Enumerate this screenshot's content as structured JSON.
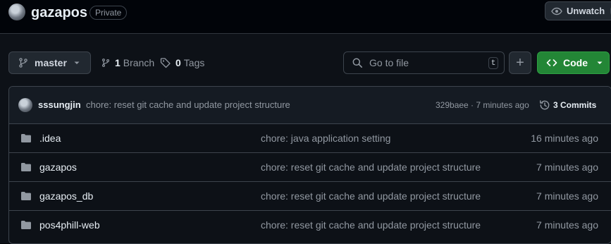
{
  "header": {
    "repo_name": "gazapos",
    "visibility_badge": "Private",
    "unwatch_label": "Unwatch"
  },
  "toolbar": {
    "branch_name": "master",
    "branch_count": "1",
    "branch_label": "Branch",
    "tag_count": "0",
    "tag_label": "Tags",
    "search_placeholder": "Go to file",
    "search_shortcut": "t",
    "add_label": "+",
    "code_label": "Code"
  },
  "latest_commit": {
    "author": "sssungjin",
    "message": "chore: reset git cache and update project structure",
    "hash_time": "329baee · 7 minutes ago",
    "commits_label": "3 Commits"
  },
  "files": [
    {
      "name": ".idea",
      "message": "chore: java application setting",
      "time": "16 minutes ago",
      "icon": "folder-icon"
    },
    {
      "name": "gazapos",
      "message": "chore: reset git cache and update project structure",
      "time": "7 minutes ago",
      "icon": "folder-icon"
    },
    {
      "name": "gazapos_db",
      "message": "chore: reset git cache and update project structure",
      "time": "7 minutes ago",
      "icon": "folder-icon"
    },
    {
      "name": "pos4phill-web",
      "message": "chore: reset git cache and update project structure",
      "time": "7 minutes ago",
      "icon": "folder-icon"
    }
  ],
  "colors": {
    "background": "#0d1117",
    "code_button": "#238636",
    "border": "#3d444d",
    "muted_text": "#9198a1",
    "folder_icon": "#9198a1"
  }
}
